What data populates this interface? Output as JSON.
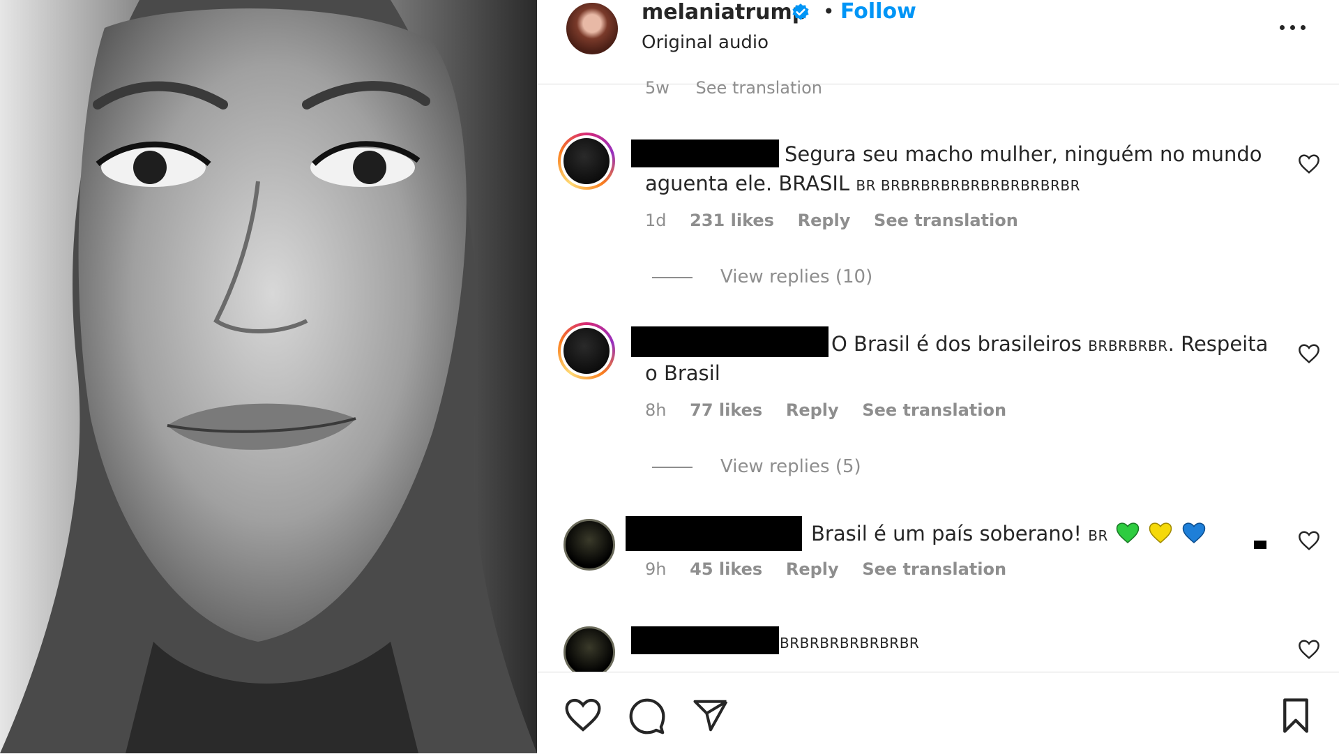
{
  "post": {
    "username": "melaniatrump",
    "verified_icon": "verified-badge-icon",
    "separator": "•",
    "follow_label": "Follow",
    "audio_label": "Original audio",
    "previous_comment_meta": {
      "time": "5w",
      "see_translation": "See translation"
    }
  },
  "comments": [
    {
      "text": "Segura seu macho mulher, ninguém no mundo",
      "text_line2": "aguenta ele. BRASIL ",
      "flags": "BR BRBRBRBRBRBRBRBRBRBR",
      "time": "1d",
      "likes": "231 likes",
      "reply": "Reply",
      "see_translation": "See translation",
      "view_replies": "View replies (10)"
    },
    {
      "text": "O Brasil é dos brasileiros ",
      "flags": "BRBRBRBR",
      "text_after_flags": ". Respeita",
      "text_line2": "o Brasil",
      "time": "8h",
      "likes": "77 likes",
      "reply": "Reply",
      "see_translation": "See translation",
      "view_replies": "View replies (5)"
    },
    {
      "text": "Brasil é um país soberano! ",
      "flags": "BR",
      "time": "9h",
      "likes": "45 likes",
      "reply": "Reply",
      "see_translation": "See translation"
    },
    {
      "flags": "BRBRBRBRBRBRBR"
    }
  ],
  "colors": {
    "follow": "#0095f6",
    "meta_gray": "#8e8e8e",
    "heart_green": "#2ecc40",
    "heart_yellow": "#f5d90a",
    "heart_blue": "#1e7fd8"
  },
  "actions": [
    "like-icon",
    "comment-icon",
    "share-icon",
    "save-icon"
  ]
}
